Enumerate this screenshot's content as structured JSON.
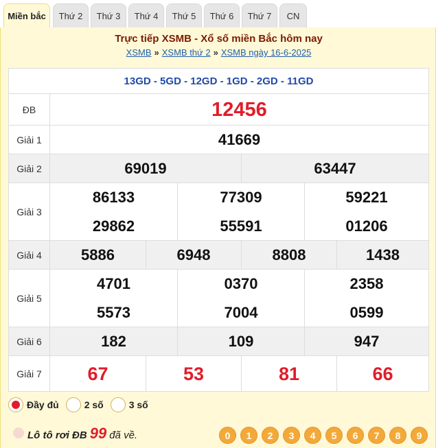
{
  "tabs": [
    "Miền bắc",
    "Thứ 2",
    "Thứ 3",
    "Thứ 4",
    "Thứ 5",
    "Thứ 6",
    "Thứ 7",
    "CN"
  ],
  "header": {
    "title": "Trực tiếp XSMB - Xổ số miền Bắc hôm nay",
    "crumbs": [
      "XSMB",
      "XSMB thứ 2",
      "XSMB ngày 16-6-2025"
    ],
    "separator": "»"
  },
  "codes": "13GD - 5GD - 12GD - 1GD - 2GD - 11GD",
  "prizes": {
    "db": {
      "label": "ĐB",
      "values": [
        "12456"
      ]
    },
    "g1": {
      "label": "Giải 1",
      "values": [
        "41669"
      ]
    },
    "g2": {
      "label": "Giải 2",
      "values": [
        "69019",
        "63447"
      ]
    },
    "g3": {
      "label": "Giải 3",
      "values": [
        "86133",
        "77309",
        "59221",
        "29862",
        "55591",
        "01206"
      ]
    },
    "g4": {
      "label": "Giải 4",
      "values": [
        "5886",
        "6948",
        "8808",
        "1438"
      ]
    },
    "g5": {
      "label": "Giải 5",
      "values": [
        "4701",
        "0370",
        "2358",
        "5573",
        "7004",
        "0599"
      ]
    },
    "g6": {
      "label": "Giải 6",
      "values": [
        "182",
        "109",
        "947"
      ]
    },
    "g7": {
      "label": "Giải 7",
      "values": [
        "67",
        "53",
        "81",
        "66"
      ]
    }
  },
  "options": [
    "Đầy đủ",
    "2 số",
    "3 số"
  ],
  "selected_option": "Đầy đủ",
  "footer": {
    "prefix": "Lô tô rơi ĐB",
    "number": "99",
    "suffix": "đã về."
  },
  "balls": [
    "0",
    "1",
    "2",
    "3",
    "4",
    "5",
    "6",
    "7",
    "8",
    "9"
  ],
  "colors": {
    "accent_red": "#e11d2a",
    "code_blue": "#1f4aa8",
    "header_bg": "#fff9d8",
    "ball": "#f3a93a"
  }
}
